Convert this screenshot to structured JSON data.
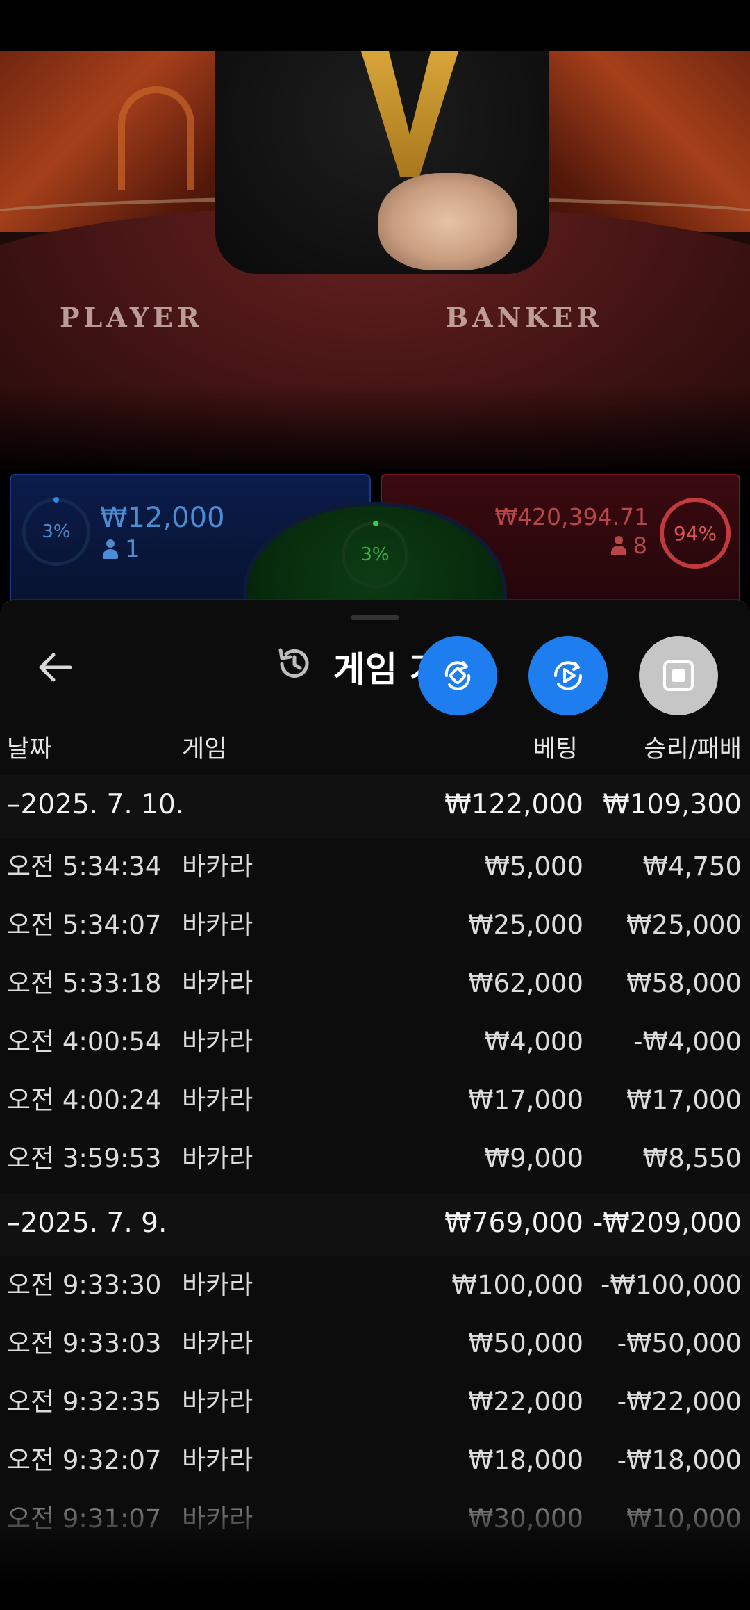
{
  "video": {
    "player_label": "PLAYER",
    "banker_label": "BANKER"
  },
  "bets": {
    "player": {
      "percent": "3%",
      "amount": "₩12,000",
      "count": "1",
      "color": "#4b8cd3"
    },
    "tie": {
      "percent": "3%",
      "color": "#3cae4a"
    },
    "banker": {
      "percent": "94%",
      "amount": "₩420,394.71",
      "count": "8",
      "color": "#c03a3e"
    }
  },
  "sheet": {
    "title": "게임 기록",
    "icons": {
      "back": "back-arrow-icon",
      "history": "history-icon"
    },
    "fabs": [
      {
        "name": "rotate-screen-button",
        "icon": "rotate-icon",
        "color": "#1e7ef0"
      },
      {
        "name": "replay-button",
        "icon": "replay-icon",
        "color": "#1e7ef0"
      },
      {
        "name": "stop-button",
        "icon": "stop-icon",
        "color": "#c6c6c6"
      }
    ],
    "columns": {
      "date": "날짜",
      "game": "게임",
      "bet": "베팅",
      "winloss": "승리/패배"
    }
  },
  "groups": [
    {
      "date": "–2025. 7. 10.",
      "bet_total": "₩122,000",
      "win_total": "₩109,300",
      "rows": [
        {
          "time": "오전 5:34:34",
          "game": "바카라",
          "bet": "₩5,000",
          "win": "₩4,750"
        },
        {
          "time": "오전 5:34:07",
          "game": "바카라",
          "bet": "₩25,000",
          "win": "₩25,000"
        },
        {
          "time": "오전 5:33:18",
          "game": "바카라",
          "bet": "₩62,000",
          "win": "₩58,000"
        },
        {
          "time": "오전 4:00:54",
          "game": "바카라",
          "bet": "₩4,000",
          "win": "-₩4,000"
        },
        {
          "time": "오전 4:00:24",
          "game": "바카라",
          "bet": "₩17,000",
          "win": "₩17,000"
        },
        {
          "time": "오전 3:59:53",
          "game": "바카라",
          "bet": "₩9,000",
          "win": "₩8,550"
        }
      ]
    },
    {
      "date": "–2025. 7. 9.",
      "bet_total": "₩769,000",
      "win_total": "-₩209,000",
      "rows": [
        {
          "time": "오전 9:33:30",
          "game": "바카라",
          "bet": "₩100,000",
          "win": "-₩100,000"
        },
        {
          "time": "오전 9:33:03",
          "game": "바카라",
          "bet": "₩50,000",
          "win": "-₩50,000"
        },
        {
          "time": "오전 9:32:35",
          "game": "바카라",
          "bet": "₩22,000",
          "win": "-₩22,000"
        },
        {
          "time": "오전 9:32:07",
          "game": "바카라",
          "bet": "₩18,000",
          "win": "-₩18,000"
        },
        {
          "time": "오전 9:31:07",
          "game": "바카라",
          "bet": "₩30,000",
          "win": "₩10,000"
        }
      ]
    }
  ]
}
